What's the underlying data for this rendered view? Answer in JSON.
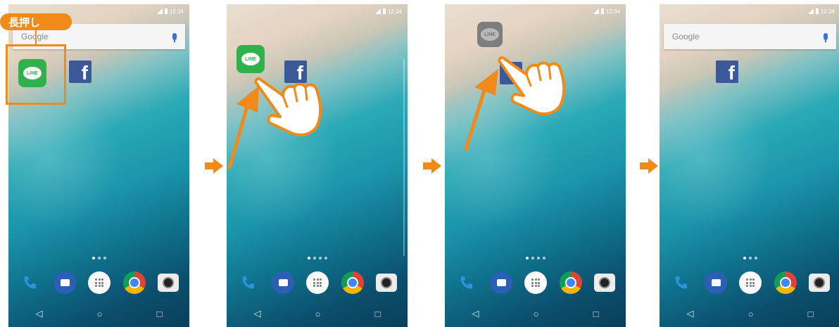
{
  "callout": {
    "label": "長押し"
  },
  "colors": {
    "accent": "#f08a18",
    "line_green": "#2fb24c",
    "facebook": "#3b5998"
  },
  "icons": {
    "step": "arrow-right-icon",
    "hand": "pointing-hand-icon",
    "drag": "drag-arrow-icon",
    "back": "back-triangle-icon",
    "home": "home-circle-icon",
    "recent": "recent-square-icon"
  },
  "screens": [
    {
      "time": "12:34",
      "search_label": "Google",
      "line_label": "LINE",
      "fb_label": "f",
      "nav": {
        "back": "◁",
        "home": "○",
        "recent": "□"
      }
    },
    {
      "time": "12:34",
      "line_label": "LINE",
      "fb_label": "f",
      "nav": {
        "back": "◁",
        "home": "○",
        "recent": "□"
      }
    },
    {
      "time": "12:34",
      "line_label": "LINE",
      "fb_label": "f",
      "nav": {
        "back": "◁",
        "home": "○",
        "recent": "□"
      }
    },
    {
      "time": "12:34",
      "search_label": "Google",
      "fb_label": "f",
      "nav": {
        "back": "◁",
        "home": "○",
        "recent": "□"
      }
    }
  ]
}
